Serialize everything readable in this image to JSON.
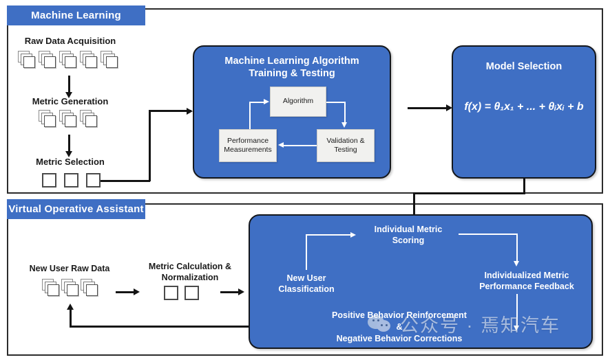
{
  "diagram": {
    "title_ml": "Machine Learning",
    "title_voa": "Virtual Operative Assistant",
    "accent_color": "#3f6fc4",
    "frame_color": "#2b2b2b",
    "inner_box_color": "#f1f1ef"
  },
  "ml_section": {
    "pipeline": [
      {
        "label": "Raw Data Acquisition",
        "icon": "document-stack",
        "count": 5
      },
      {
        "label": "Metric Generation",
        "icon": "document-stack",
        "count": 3
      },
      {
        "label": "Metric Selection",
        "icon": "empty-square",
        "count": 3
      }
    ],
    "algorithm_box": {
      "title_line1": "Machine Learning Algorithm",
      "title_line2": "Training & Testing",
      "nodes": [
        {
          "id": "algorithm",
          "label": "Algorithm"
        },
        {
          "id": "validation",
          "label_line1": "Validation &",
          "label_line2": "Testing"
        },
        {
          "id": "performance",
          "label_line1": "Performance",
          "label_line2": "Measurements"
        }
      ]
    },
    "model_box": {
      "title": "Model Selection",
      "formula_plain": "f(x) = θ₁x₁ + ... + θᵢxᵢ + b",
      "formula_parts": {
        "lead": "f(x) = ",
        "theta1": "θ",
        "sub1": "1",
        "x1": "x",
        "xsub1": "1",
        "mid": " + ... + ",
        "thetai": "θ",
        "subi": "i",
        "xi": "x",
        "xsubi": "i",
        "tail": " + b"
      }
    }
  },
  "voa_section": {
    "pipeline": [
      {
        "label": "New User Raw Data",
        "icon": "document-stack",
        "count": 3
      },
      {
        "label_line1": "Metric Calculation &",
        "label_line2": "Normalization",
        "icon": "empty-square",
        "count": 2
      }
    ],
    "assistant_box": {
      "nodes": [
        {
          "id": "new-user-classification",
          "label_line1": "New User",
          "label_line2": "Classification"
        },
        {
          "id": "individual-metric-scoring",
          "label_line1": "Individual Metric",
          "label_line2": "Scoring"
        },
        {
          "id": "individualized-feedback",
          "label_line1": "Individualized Metric",
          "label_line2": "Performance Feedback"
        },
        {
          "id": "behavior-outcomes",
          "label_line1": "Positive Behavior Reinforcement",
          "label_line2": "&",
          "label_line3": "Negative Behavior Corrections"
        }
      ]
    }
  },
  "watermark": {
    "text": "公众号 · 焉知汽车",
    "icon": "wechat-logo"
  }
}
